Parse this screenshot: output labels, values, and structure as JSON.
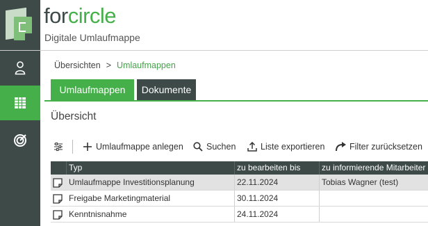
{
  "header": {
    "brand_part1": "for",
    "brand_part2": "circle",
    "subtitle": "Digitale Umlaufmappe"
  },
  "sidebar": {
    "items": [
      {
        "icon": "user-icon",
        "active": false
      },
      {
        "icon": "table-grid-icon",
        "active": true
      },
      {
        "icon": "chart-icon",
        "active": false
      }
    ]
  },
  "breadcrumb": {
    "root": "Übersichten",
    "separator": ">",
    "current": "Umlaufmappen"
  },
  "tabs": [
    {
      "label": "Umlaufmappen",
      "active": true
    },
    {
      "label": "Dokumente",
      "active": false
    }
  ],
  "section_title": "Übersicht",
  "toolbar": {
    "filter_settings_icon": "sliders-icon",
    "create_label": "Umlaufmappe anlegen",
    "search_label": "Suchen",
    "export_label": "Liste exportieren",
    "reset_label": "Filter zurücksetzen"
  },
  "table": {
    "columns": [
      "Typ",
      "zu bearbeiten bis",
      "zu informierende Mitarbeiter"
    ],
    "rows": [
      {
        "typ": "Umlaufmappe Investitionsplanung",
        "due": "22.11.2024",
        "inform": "Tobias Wagner (test)",
        "selected": true
      },
      {
        "typ": "Freigabe Marketingmaterial",
        "due": "30.11.2024",
        "inform": "",
        "selected": false
      },
      {
        "typ": "Kenntnisnahme",
        "due": "24.11.2024",
        "inform": "",
        "selected": false
      }
    ]
  },
  "colors": {
    "brand_green": "#45b04a",
    "dark_slate": "#3d4a48"
  }
}
